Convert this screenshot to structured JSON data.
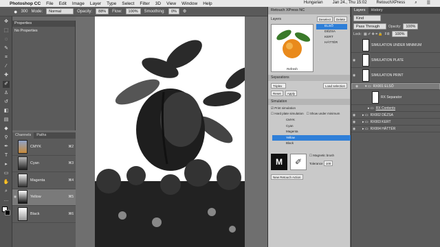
{
  "menubar": {
    "app": "Photoshop CC",
    "items": [
      "File",
      "Edit",
      "Image",
      "Layer",
      "Type",
      "Select",
      "Filter",
      "3D",
      "View",
      "Window",
      "Help"
    ],
    "language": "Hungarian",
    "clock": "Jan 24., Thu 15:02",
    "account": "RetouchXPress"
  },
  "options": {
    "brush_size": "300",
    "mode_label": "Mode:",
    "mode_value": "Normal",
    "opacity_label": "Opacity:",
    "opacity_value": "88%",
    "flow_label": "Flow:",
    "flow_value": "100%",
    "smoothing_label": "Smoothing:",
    "smoothing_value": "0%"
  },
  "properties": {
    "title": "Properties",
    "subtitle": "No Properties"
  },
  "channels": {
    "tabs": [
      "Channels",
      "Paths"
    ],
    "rows": [
      {
        "name": "CMYK",
        "short": "⌘2"
      },
      {
        "name": "Cyan",
        "short": "⌘3"
      },
      {
        "name": "Magenta",
        "short": "⌘4"
      },
      {
        "name": "Yellow",
        "short": "⌘5"
      },
      {
        "name": "Black",
        "short": "⌘6"
      }
    ]
  },
  "xpress": {
    "title": "Retouch XPress NC",
    "layers_label": "Layers",
    "deselect": "Deselect",
    "delete": "Delete",
    "layer_list": [
      "ELSŐ",
      "DÉZSA",
      "KERT",
      "HÁTTÉR"
    ],
    "refresh": "Refresh",
    "separations_label": "Separations",
    "triple": "Triplex",
    "load_selection": "Load selection",
    "reset": "Reset",
    "apply": "Apply",
    "simulation_label": "Simulation",
    "print_sim": "Print simulation",
    "hard_plate": "Hard plate simulation",
    "show_under": "Show under minimum",
    "sim_channels": [
      "CMYK",
      "Cyan",
      "Magenta",
      "Yellow",
      "Black"
    ],
    "magnetic_brush": "Magnetic brush",
    "tolerance_label": "Tolerance",
    "tolerance_value": "100",
    "new_action": "New Retouch Action"
  },
  "layers": {
    "tabs": [
      "Layers",
      "History"
    ],
    "kind": "Kind",
    "blend": "Pass Through",
    "opacity_label": "Opacity:",
    "opacity_value": "100%",
    "lock_label": "Lock:",
    "fill_label": "Fill:",
    "fill_value": "100%",
    "rows": [
      "SIMULATION UNDER MINIMUM",
      "SIMULATION PLATE",
      "SIMULATION PRINT",
      "RX001 ELSŐ",
      "RX Separator",
      "RX Contents",
      "RX002 DÉZSA",
      "RX003 KERT",
      "RX004 HÁTTÉR"
    ]
  }
}
